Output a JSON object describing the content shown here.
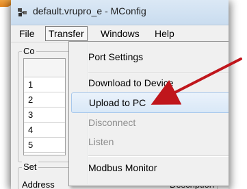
{
  "window": {
    "title": "default.vrupro_e - MConfig"
  },
  "menubar": {
    "items": [
      {
        "label": "File"
      },
      {
        "label": "Transfer"
      },
      {
        "label": "Windows"
      },
      {
        "label": "Help"
      }
    ]
  },
  "background": {
    "group_label": "Co",
    "rows": [
      "1",
      "2",
      "3",
      "4",
      "5"
    ],
    "group2_label": "Set",
    "col_address": "Address",
    "col_description": "Description"
  },
  "dropdown": {
    "items": [
      {
        "label": "Port Settings"
      },
      {
        "label": "Download to Device"
      },
      {
        "label": "Upload to PC"
      },
      {
        "label": "Disconnect"
      },
      {
        "label": "Listen"
      },
      {
        "label": "Modbus Monitor"
      }
    ]
  },
  "colors": {
    "arrow": "#c0161c",
    "hover_bg": "#dbe9f8",
    "disabled_text": "#8d8d8d"
  }
}
